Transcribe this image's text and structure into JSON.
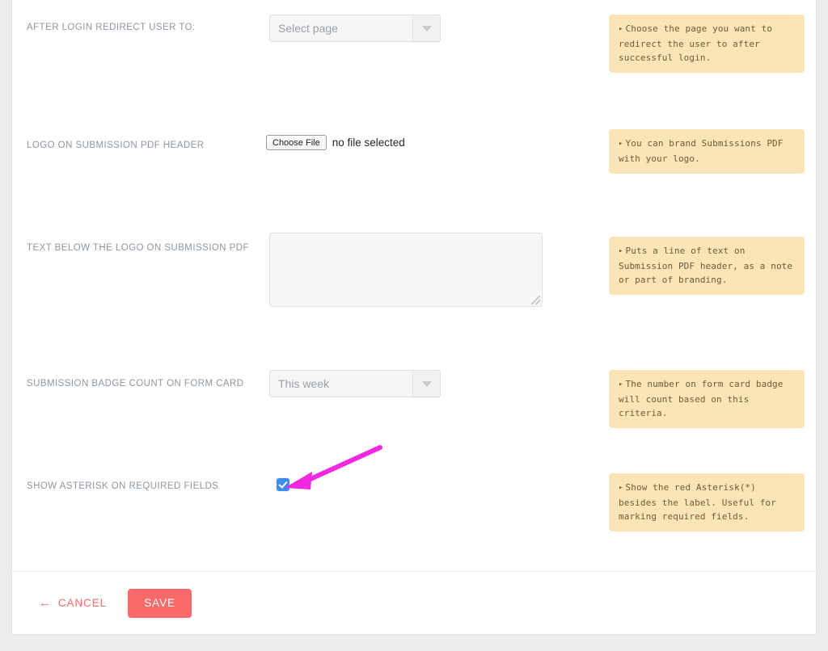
{
  "colors": {
    "accent": "#fb6a6a",
    "help_bg": "#fbe5b6",
    "help_text": "#6f5a3a",
    "label": "#8d97a0",
    "checkbox_on": "#3c8df0",
    "annotation_arrow": "#f228e0",
    "page_bg": "#ececec",
    "card_bg": "#ffffff"
  },
  "rows": [
    {
      "label": "AFTER LOGIN REDIRECT USER TO:",
      "control": "select",
      "value": "Select page",
      "help_bullet": "▸",
      "help": "Choose the page you want to redirect the user to after successful login."
    },
    {
      "label": "LOGO ON SUBMISSION PDF HEADER",
      "control": "file",
      "button_label": "Choose File",
      "status": "no file selected",
      "help_bullet": "▸",
      "help": "You can brand Submissions PDF with your logo."
    },
    {
      "label": "TEXT BELOW THE LOGO ON SUBMISSION PDF",
      "control": "textarea",
      "value": "",
      "help_bullet": "▸",
      "help": "Puts a line of text on Submission PDF header, as a note or part of branding."
    },
    {
      "label": "SUBMISSION BADGE COUNT ON FORM CARD",
      "control": "select",
      "value": "This week",
      "help_bullet": "▸",
      "help": "The number on form card badge will count based on this criteria."
    },
    {
      "label": "SHOW ASTERISK ON REQUIRED FIELDS",
      "control": "checkbox",
      "checked": true,
      "help_bullet": "▸",
      "help": "Show the red Asterisk(*) besides the label. Useful for marking required fields."
    }
  ],
  "footer": {
    "cancel_label": "Cancel",
    "cancel_arrow": "←",
    "save_label": "Save"
  }
}
